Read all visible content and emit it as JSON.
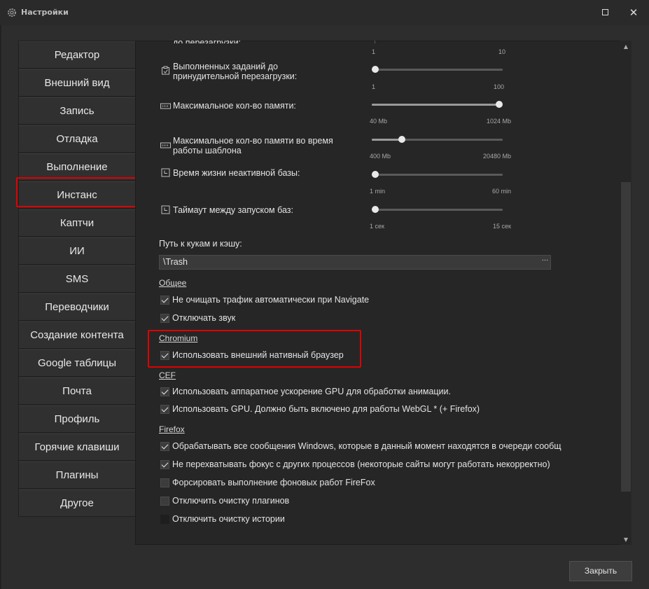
{
  "window": {
    "title": "Настройки",
    "icon": "gear-icon",
    "maximize_icon": "maximize-icon",
    "close_icon": "close-icon",
    "close_glyph": "✕"
  },
  "nav": {
    "items": [
      {
        "label": "Редактор"
      },
      {
        "label": "Внешний вид"
      },
      {
        "label": "Запись"
      },
      {
        "label": "Отладка"
      },
      {
        "label": "Выполнение"
      },
      {
        "label": "Инстанс",
        "active": true
      },
      {
        "label": "Каптчи"
      },
      {
        "label": "ИИ"
      },
      {
        "label": "SMS"
      },
      {
        "label": "Переводчики"
      },
      {
        "label": "Создание контента"
      },
      {
        "label": "Google таблицы"
      },
      {
        "label": "Почта"
      },
      {
        "label": "Профиль"
      },
      {
        "label": "Горячие клавиши"
      },
      {
        "label": "Плагины"
      },
      {
        "label": "Другое"
      }
    ]
  },
  "settings": {
    "partial_label": "до перезагрузки:",
    "partial_min": "1",
    "partial_max": "10",
    "sliders": [
      {
        "label_line1": "Выполненных заданий до",
        "label_line2": "принудительной перезагрузки:",
        "min": "1",
        "max": "100",
        "value_fraction": 0.0,
        "icon": "task-icon"
      },
      {
        "label_line1": "Максимальное кол-во памяти:",
        "label_line2": "",
        "min": "40 Mb",
        "max": "1024 Mb",
        "value_fraction": 1.0,
        "icon": "memory-icon"
      },
      {
        "label_line1": "Максимальное кол-во памяти во время",
        "label_line2": "работы шаблона",
        "min": "400 Mb",
        "max": "20480 Mb",
        "value_fraction": 0.22,
        "icon": "memory-icon"
      },
      {
        "label_line1": "Время жизни неактивной базы:",
        "label_line2": "",
        "min": "1 min",
        "max": "60 min",
        "value_fraction": 0.0,
        "icon": "clock-icon"
      },
      {
        "label_line1": "Таймаут между запуском баз:",
        "label_line2": "",
        "min": "1 сек",
        "max": "15 сек",
        "value_fraction": 0.0,
        "icon": "clock-icon"
      }
    ],
    "path_label": "Путь к кукам и кэшу:",
    "path_value": "\\Trash",
    "path_button": "···"
  },
  "sections": {
    "general": {
      "title": "Общее",
      "options": [
        {
          "label": "Не очищать трафик автоматически при Navigate",
          "checked": true
        },
        {
          "label": "Отключать звук",
          "checked": true
        }
      ]
    },
    "chromium": {
      "title": "Chromium",
      "options": [
        {
          "label": "Использовать внешний нативный браузер",
          "checked": true
        }
      ]
    },
    "cef": {
      "title": "CEF",
      "options": [
        {
          "label": "Использовать аппаратное ускорение GPU для обработки анимации.",
          "checked": true
        },
        {
          "label": "Использовать GPU. Должно быть включено для работы WebGL * (+ Firefox)",
          "checked": true
        }
      ]
    },
    "firefox": {
      "title": "Firefox",
      "options": [
        {
          "label": "Обрабатывать все сообщения Windows, которые в данный момент находятся в очереди сообщ",
          "checked": true
        },
        {
          "label": "Не перехватывать фокус с других процессов (некоторые сайты могут работать некорректно)",
          "checked": true
        },
        {
          "label": "Форсировать выполнение фоновых работ FireFox",
          "checked": false
        },
        {
          "label": "Отключить очистку плагинов",
          "checked": false
        },
        {
          "label": "Отключить очистку истории",
          "checked": false
        }
      ]
    }
  },
  "footer": {
    "close_label": "Закрыть"
  },
  "colors": {
    "highlight": "#e00000",
    "background": "#2d2d2d",
    "panel": "#262626"
  }
}
